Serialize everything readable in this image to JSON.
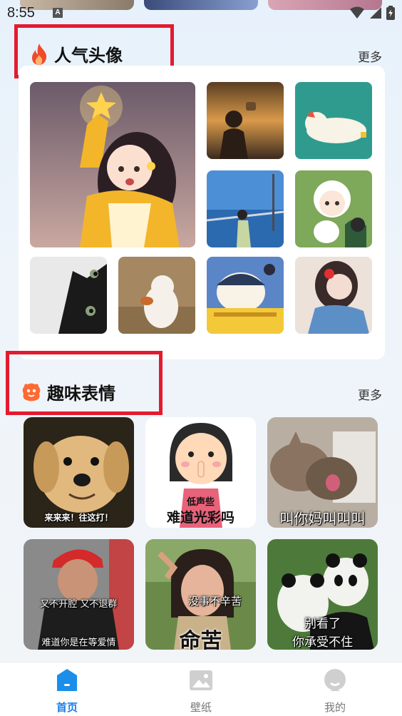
{
  "status_bar": {
    "time": "8:55",
    "notification_letter": "A",
    "icons": [
      "wifi-icon",
      "signal-icon",
      "battery-icon"
    ]
  },
  "sections": {
    "popular_avatars": {
      "title": "人气头像",
      "icon": "fire-icon",
      "more_label": "更多",
      "images": [
        "girl-with-star",
        "sunset-silhouette",
        "lying-cat-illustration",
        "seaside-girl",
        "cartoon-boy-with-cat",
        "black-cat",
        "fluffy-dog",
        "pompompurin-bus",
        "girl-with-flower"
      ]
    },
    "fun_stickers": {
      "title": "趣味表情",
      "icon": "sticker-face-icon",
      "more_label": "更多",
      "items": [
        {
          "name": "puppy-meme",
          "captions": [
            "来来来！往这打！"
          ]
        },
        {
          "name": "shush-girl-meme",
          "captions": [
            "低声些",
            "难道光彩吗"
          ]
        },
        {
          "name": "laughing-cats-meme",
          "captions": [
            "叫你妈叫叫叫"
          ]
        },
        {
          "name": "old-man-meme",
          "captions": [
            "又不开腔 又不退群",
            "难道你是在等爱情"
          ]
        },
        {
          "name": "crying-woman-meme",
          "captions": [
            "没事不辛苦",
            "命苦"
          ]
        },
        {
          "name": "pandas-meme",
          "captions": [
            "别看了",
            "你承受不住"
          ]
        }
      ]
    }
  },
  "bottom_nav": {
    "items": [
      {
        "label": "首页",
        "icon": "home-icon",
        "active": true
      },
      {
        "label": "壁纸",
        "icon": "wallpaper-icon",
        "active": false
      },
      {
        "label": "我的",
        "icon": "profile-icon",
        "active": false
      }
    ]
  },
  "colors": {
    "accent": "#1b7fe6",
    "highlight_box": "#e31b2f",
    "fire": "#f04a2a",
    "sticker_icon": "#ff6a33"
  }
}
